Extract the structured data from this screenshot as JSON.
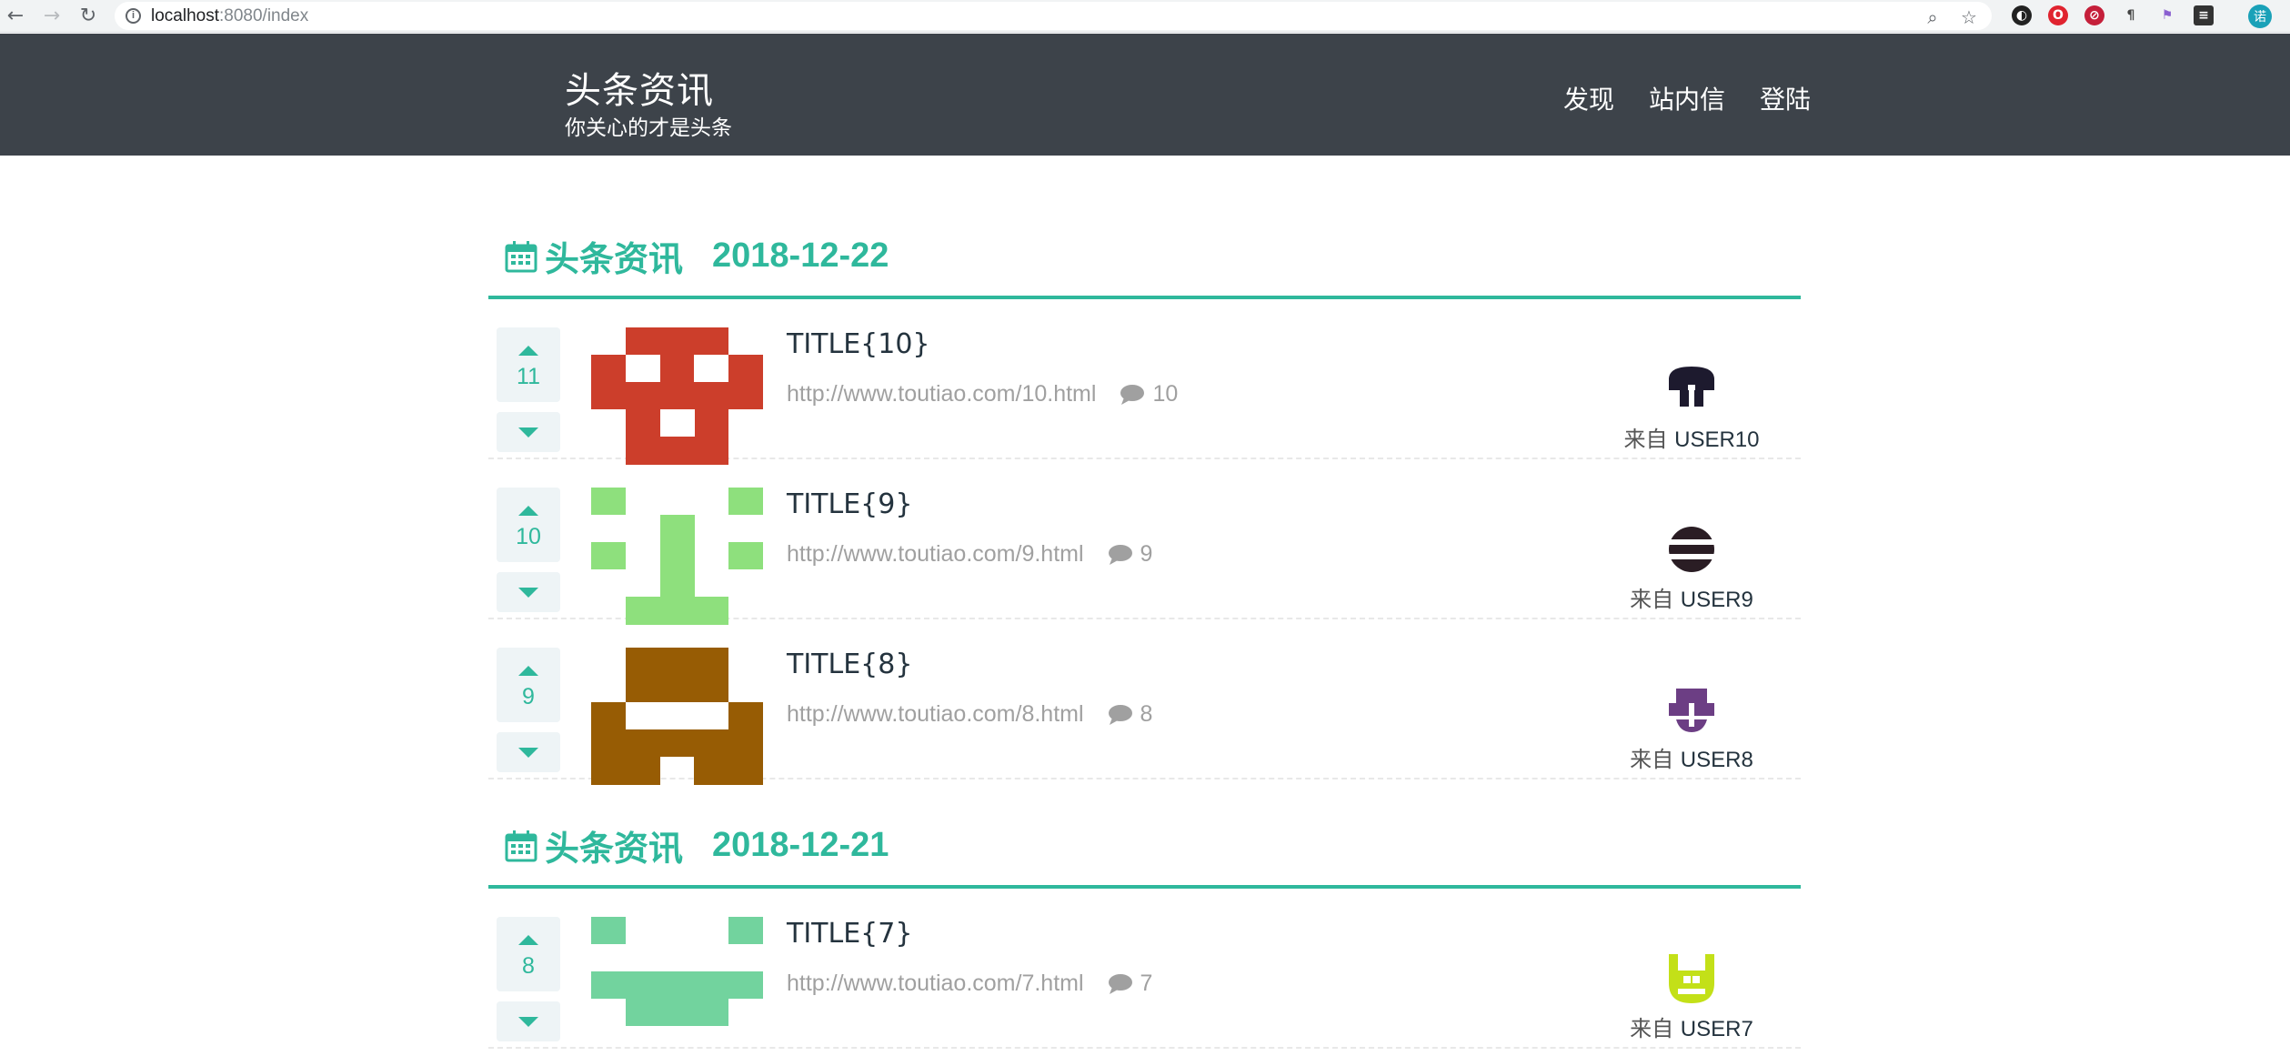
{
  "browser": {
    "url_host": "localhost",
    "url_path": ":8080/index",
    "profile_initial": "诺"
  },
  "site": {
    "title": "头条资讯",
    "subtitle": "你关心的才是头条",
    "nav": [
      "发现",
      "站内信",
      "登陆"
    ]
  },
  "days": [
    {
      "label": "头条资讯",
      "date": "2018-12-22",
      "items": [
        {
          "votes": "11",
          "title": "TITLE{10}",
          "link": "http://www.toutiao.com/10.html",
          "comments": "10",
          "from": "来自",
          "user": "USER10",
          "thumb_color": "#cc3e2b",
          "avatar_color": "#1d1a2e"
        },
        {
          "votes": "10",
          "title": "TITLE{9}",
          "link": "http://www.toutiao.com/9.html",
          "comments": "9",
          "from": "来自",
          "user": "USER9",
          "thumb_color": "#8ee07d",
          "avatar_color": "#2a1d24"
        },
        {
          "votes": "9",
          "title": "TITLE{8}",
          "link": "http://www.toutiao.com/8.html",
          "comments": "8",
          "from": "来自",
          "user": "USER8",
          "thumb_color": "#975c04",
          "avatar_color": "#6c3e84"
        }
      ]
    },
    {
      "label": "头条资讯",
      "date": "2018-12-21",
      "items": [
        {
          "votes": "8",
          "title": "TITLE{7}",
          "link": "http://www.toutiao.com/7.html",
          "comments": "7",
          "from": "来自",
          "user": "USER7",
          "thumb_color": "#72d39e",
          "avatar_color": "#c3e018"
        }
      ]
    }
  ],
  "colors": {
    "accent": "#2fb89c",
    "header_bg": "#3d434a"
  }
}
